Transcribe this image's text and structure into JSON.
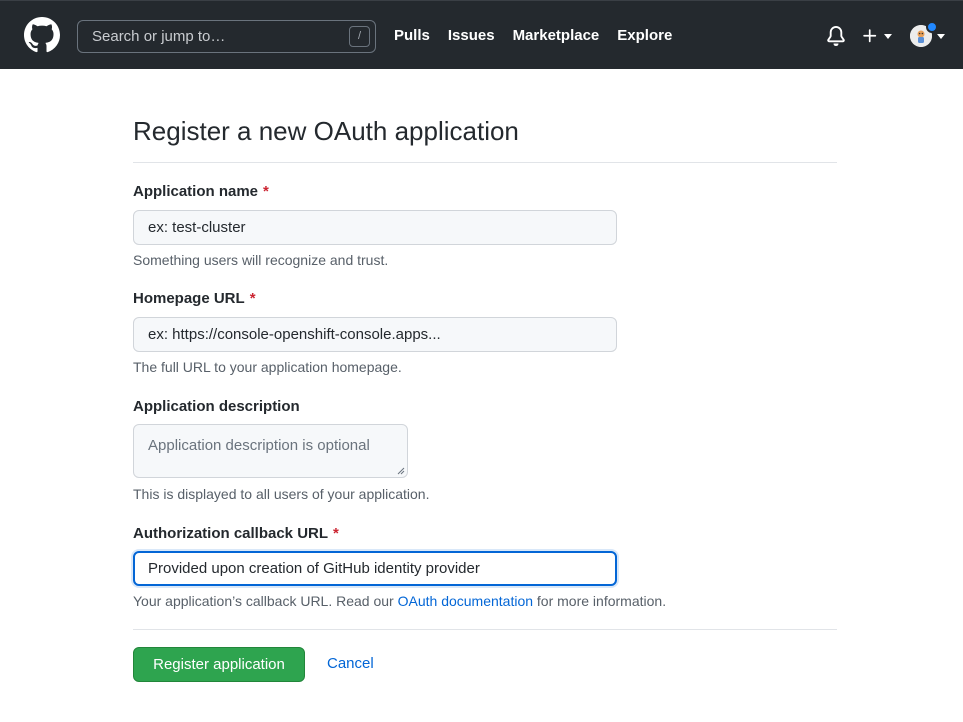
{
  "header": {
    "search_placeholder": "Search or jump to…",
    "search_shortcut": "/",
    "nav": [
      "Pulls",
      "Issues",
      "Marketplace",
      "Explore"
    ],
    "icons": [
      "github-logo",
      "bell-icon",
      "plus-icon",
      "avatar"
    ],
    "colors": {
      "bg": "#24292e",
      "notification": "#2188ff"
    }
  },
  "page": {
    "title": "Register a new OAuth application"
  },
  "form": {
    "app_name": {
      "label": "Application name",
      "required_mark": "*",
      "value": "ex: test-cluster",
      "note": "Something users will recognize and trust."
    },
    "homepage_url": {
      "label": "Homepage URL",
      "required_mark": "*",
      "value": "ex: https://console-openshift-console.apps...",
      "note": "The full URL to your application homepage."
    },
    "description": {
      "label": "Application description",
      "placeholder": "Application description is optional",
      "note": "This is displayed to all users of your application."
    },
    "callback_url": {
      "label": "Authorization callback URL",
      "required_mark": "*",
      "value": "Provided upon creation of GitHub identity provider",
      "note_before": "Your application’s callback URL. Read our ",
      "note_link": "OAuth documentation",
      "note_after": " for more information."
    }
  },
  "actions": {
    "submit": "Register application",
    "cancel": "Cancel",
    "colors": {
      "primary": "#2ea44f",
      "link": "#0366d6",
      "required": "#cb2431"
    }
  }
}
